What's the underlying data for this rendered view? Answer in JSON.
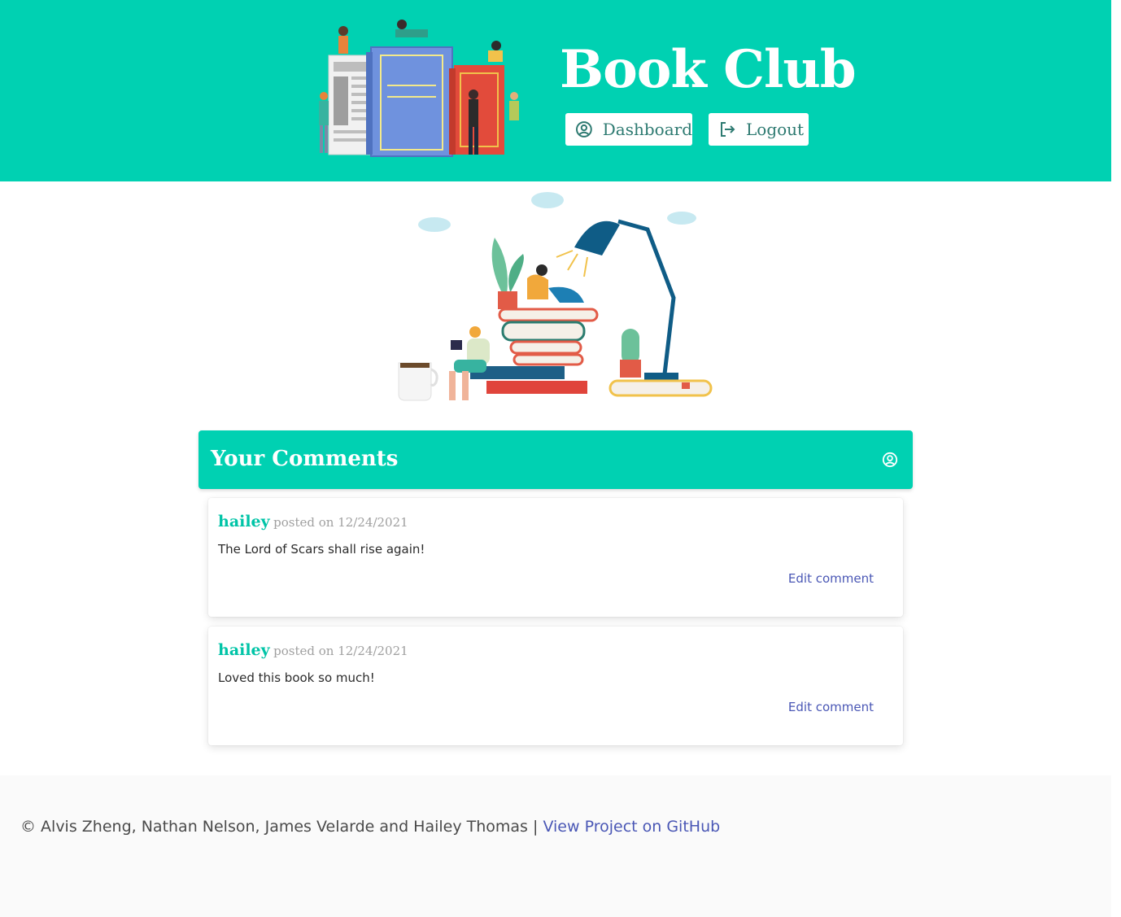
{
  "header": {
    "title": "Book Club",
    "nav": {
      "dashboard_label": "Dashboard",
      "logout_label": "Logout"
    },
    "art_icon": "books-with-readers-illustration"
  },
  "hero": {
    "art_icon": "reader-on-book-stack-with-lamp-illustration"
  },
  "comments_section": {
    "title": "Your Comments",
    "icon": "user-circle-icon",
    "items": [
      {
        "user": "hailey",
        "posted": "posted on 12/24/2021",
        "text": "The Lord of Scars shall rise again!",
        "edit_label": "Edit comment"
      },
      {
        "user": "hailey",
        "posted": "posted on 12/24/2021",
        "text": "Loved this book so much!",
        "edit_label": "Edit comment"
      }
    ]
  },
  "footer": {
    "credits": "© Alvis Zheng, Nathan Nelson, James Velarde and Hailey Thomas |",
    "github_link": "View Project on GitHub"
  },
  "colors": {
    "brand": "#00d1b2",
    "link": "#4a57b5",
    "username": "#00c4a7",
    "footer_bg": "#fafafa"
  }
}
